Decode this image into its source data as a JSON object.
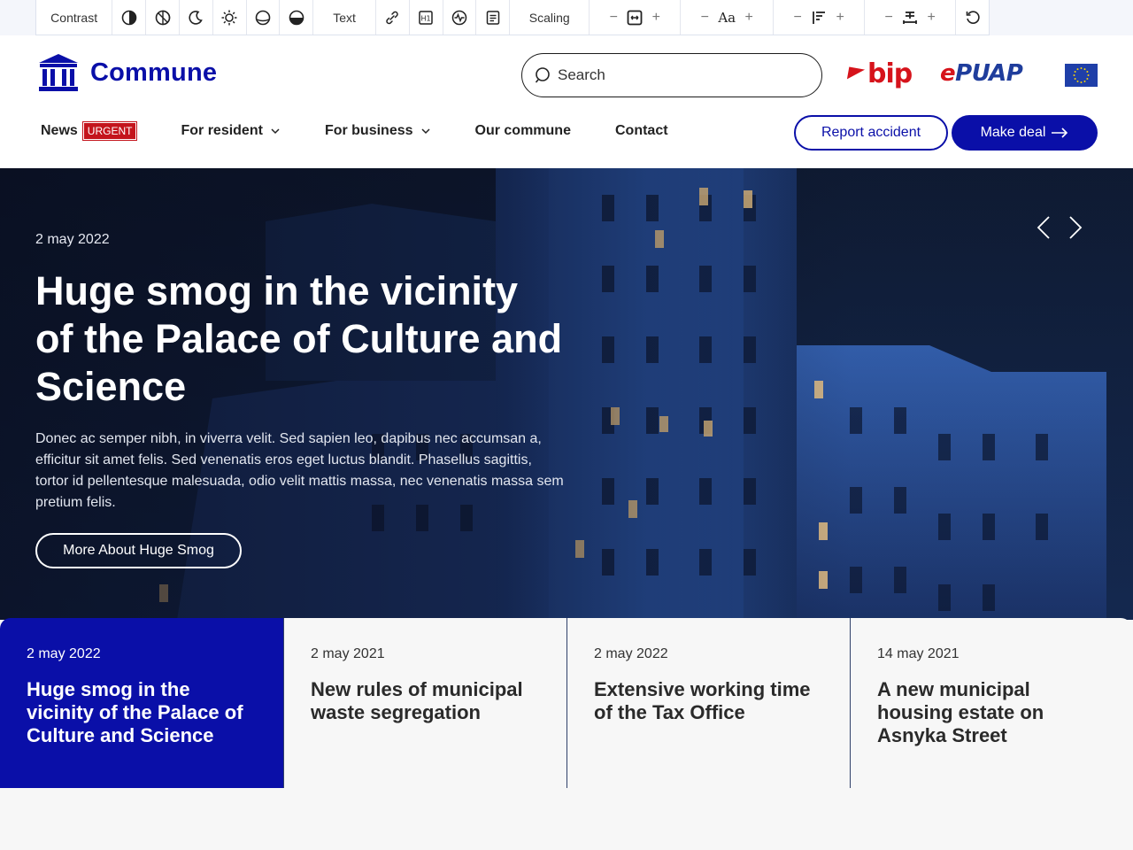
{
  "toolbar": {
    "contrast_label": "Contrast",
    "text_label": "Text",
    "scaling_label": "Scaling",
    "minus": "−",
    "plus": "+",
    "font_sample": "Aa"
  },
  "header": {
    "logo_text": "Commune",
    "search_placeholder": "Search",
    "bip_text": "bip",
    "epuap_e": "e",
    "epuap_rest": "PUAP"
  },
  "nav": {
    "news": "News",
    "urgent": "URGENT",
    "for_resident": "For resident",
    "for_business": "For business",
    "our_commune": "Our commune",
    "contact": "Contact",
    "report_accident": "Report accident",
    "make_deal": "Make deal"
  },
  "hero": {
    "date": "2 may 2022",
    "title": "Huge smog in the vicinity of the Palace of Culture and Science",
    "description": "Donec ac semper nibh, in viverra velit. Sed sapien leo, dapibus nec accumsan a, efficitur sit amet felis. Sed venenatis eros eget luctus blandit. Phasellus sagittis, tortor id pellentesque malesuada, odio velit mattis massa, nec venenatis massa sem pretium felis.",
    "button": "More About Huge Smog"
  },
  "news": [
    {
      "date": "2 may 2022",
      "title": "Huge smog in the vicinity of the Palace of Culture and Science",
      "active": true
    },
    {
      "date": "2 may 2021",
      "title": "New rules of municipal waste segregation",
      "active": false
    },
    {
      "date": "2 may 2022",
      "title": "Extensive working time of the Tax Office",
      "active": false
    },
    {
      "date": "14 may 2021",
      "title": "A new municipal housing estate on Asnyka Street",
      "active": false
    }
  ],
  "colors": {
    "brand": "#0a0fa8",
    "urgent": "#c4141c",
    "bip_red": "#d6131b",
    "epuap_blue": "#1f3d9c"
  }
}
